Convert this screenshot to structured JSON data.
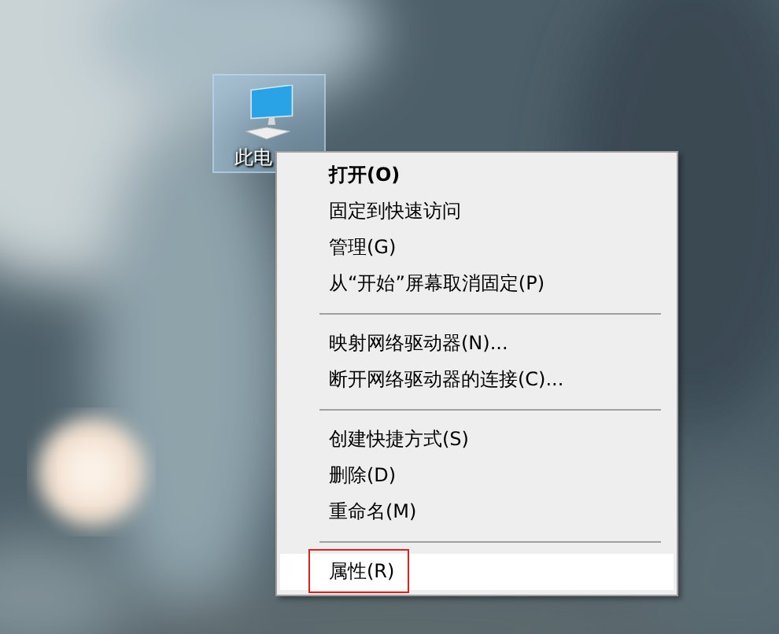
{
  "desktop_icon": {
    "label": "此电",
    "selected": true
  },
  "context_menu": {
    "items": [
      {
        "kind": "item",
        "label": "打开(O)",
        "default": true,
        "selected": false,
        "annotated": false
      },
      {
        "kind": "item",
        "label": "固定到快速访问",
        "default": false,
        "selected": false,
        "annotated": false
      },
      {
        "kind": "item",
        "label": "管理(G)",
        "default": false,
        "selected": false,
        "annotated": false
      },
      {
        "kind": "item",
        "label": "从“开始”屏幕取消固定(P)",
        "default": false,
        "selected": false,
        "annotated": false
      },
      {
        "kind": "separator"
      },
      {
        "kind": "item",
        "label": "映射网络驱动器(N)...",
        "default": false,
        "selected": false,
        "annotated": false
      },
      {
        "kind": "item",
        "label": "断开网络驱动器的连接(C)...",
        "default": false,
        "selected": false,
        "annotated": false
      },
      {
        "kind": "separator"
      },
      {
        "kind": "item",
        "label": "创建快捷方式(S)",
        "default": false,
        "selected": false,
        "annotated": false
      },
      {
        "kind": "item",
        "label": "删除(D)",
        "default": false,
        "selected": false,
        "annotated": false
      },
      {
        "kind": "item",
        "label": "重命名(M)",
        "default": false,
        "selected": false,
        "annotated": false
      },
      {
        "kind": "separator"
      },
      {
        "kind": "item",
        "label": "属性(R)",
        "default": false,
        "selected": true,
        "annotated": true
      }
    ]
  }
}
